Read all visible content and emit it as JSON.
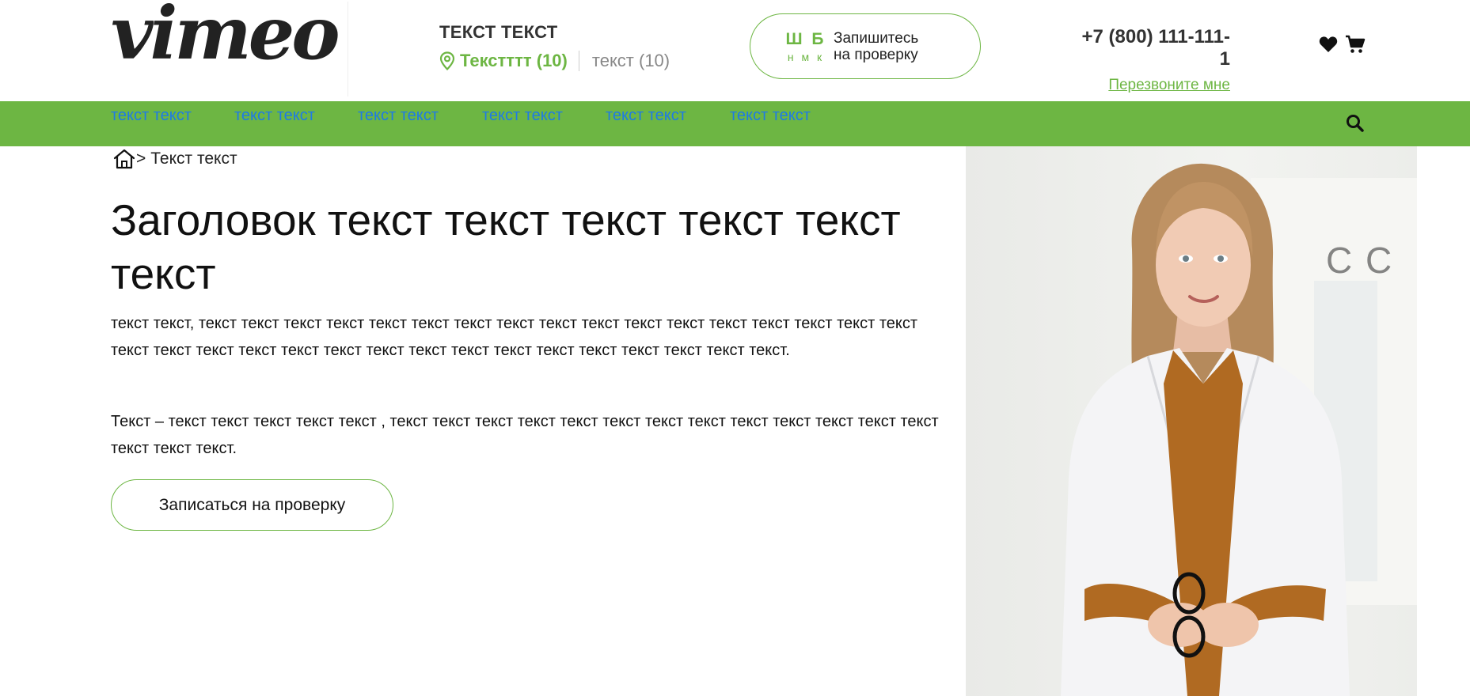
{
  "header": {
    "logo_text": "vimeo",
    "location": {
      "title": "ТЕКСТ ТЕКСТ",
      "active_link": "Текстттт (10)",
      "other_link": "текст (10)"
    },
    "signup": {
      "letters_top": "Ш Б",
      "letters_bottom": "н м к",
      "line1": "Запишитесь",
      "line2": "на проверку"
    },
    "phone": "+7 (800) 111-111-1",
    "callback": "Перезвоните мне"
  },
  "nav": {
    "items": [
      {
        "label": "текст текст"
      },
      {
        "label": "текст текст"
      },
      {
        "label": "текст текст"
      },
      {
        "label": "текст текст"
      },
      {
        "label": "текст текст"
      },
      {
        "label": "текст текст"
      }
    ]
  },
  "breadcrumb": {
    "separator": ">",
    "current": "Текст текст"
  },
  "main": {
    "title": "Заголовок текст текст текст текст текст текст",
    "paragraph1": "текст текст, текст текст текст текст текст текст текст текст текст текст текст текст текст текст текст текст текст текст текст текст текст текст текст текст текст текст текст текст текст текст текст текст текст.",
    "paragraph2": "Текст – текст текст текст текст текст , текст текст текст текст текст текст текст текст текст текст текст текст текст текст текст текст.",
    "cta_label": "Записаться на проверку"
  },
  "colors": {
    "accent_green": "#6db643",
    "nav_link_blue": "#1e7ae6"
  },
  "icons": [
    "location-pin-icon",
    "heart-icon",
    "cart-icon",
    "search-icon",
    "home-icon"
  ]
}
